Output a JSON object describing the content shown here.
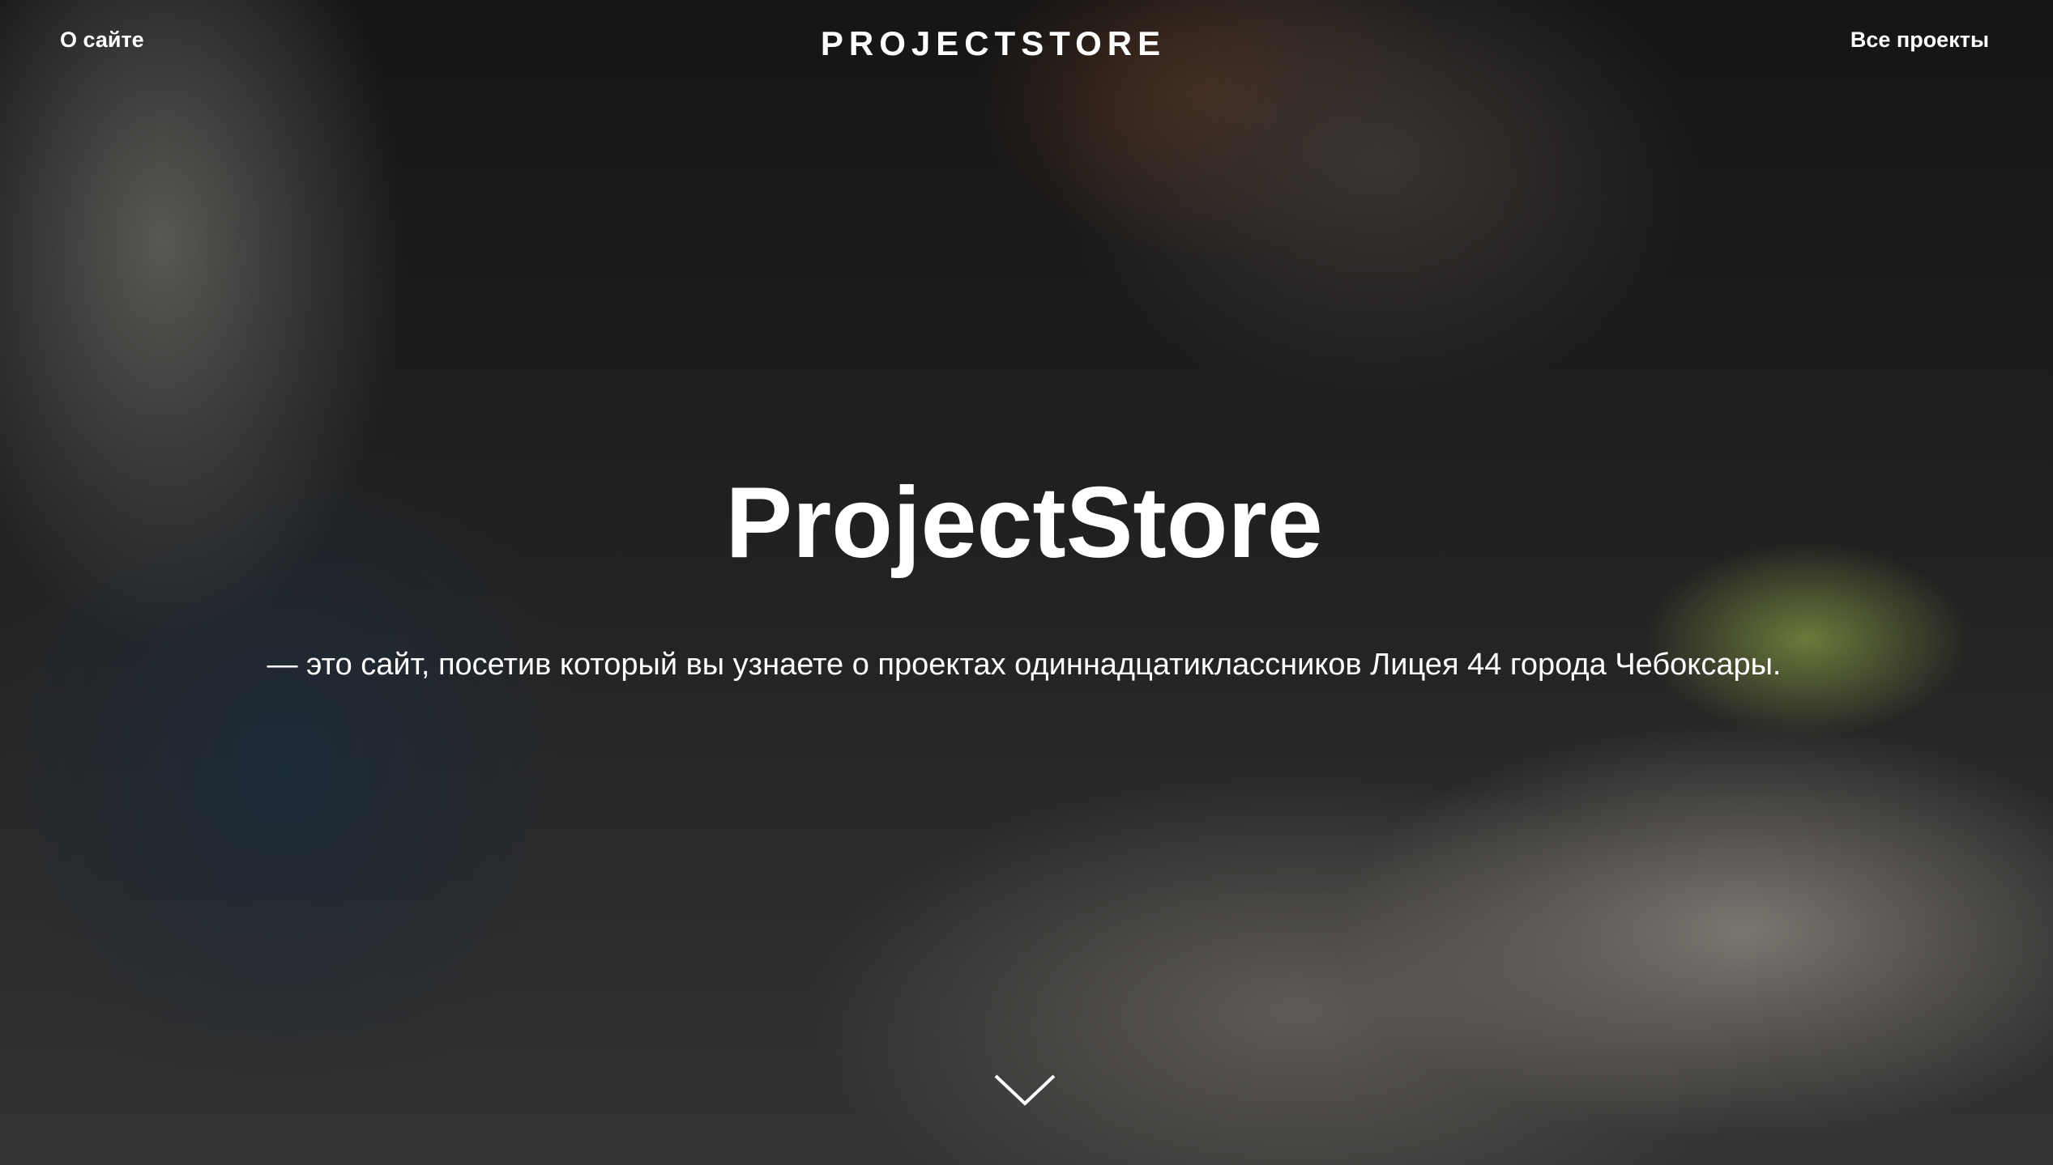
{
  "header": {
    "about_label": "О сайте",
    "logo": "PROJECTSTORE",
    "all_projects_label": "Все проекты"
  },
  "hero": {
    "title": "ProjectStore",
    "subtitle": "— это сайт, посетив который вы узнаете о проектах одиннадцатиклассников Лицея 44 города Чебоксары.",
    "scroll_icon": "chevron-down-icon"
  }
}
